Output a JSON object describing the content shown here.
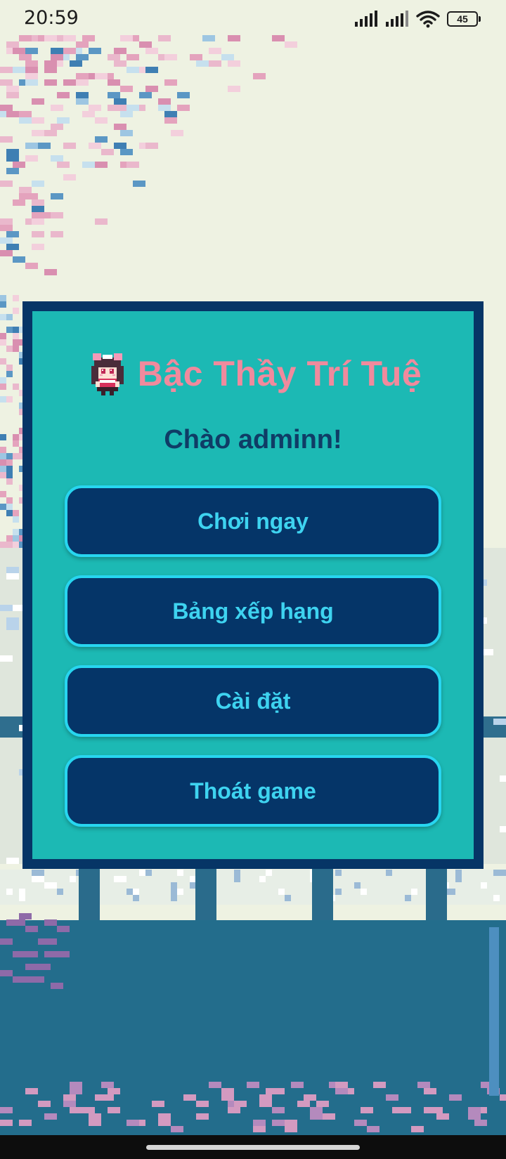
{
  "status_bar": {
    "time": "20:59",
    "battery_level": "45",
    "icons": [
      "signal-icon",
      "signal-icon",
      "wifi-icon",
      "battery-icon"
    ]
  },
  "menu": {
    "title": "Bậc Thầy Trí Tuệ",
    "greeting": "Chào adminn!",
    "buttons": {
      "play": "Chơi ngay",
      "leaderboard": "Bảng xếp hạng",
      "settings": "Cài đặt",
      "exit": "Thoát game"
    }
  },
  "colors": {
    "panel": "#1cb9b4",
    "panel_border": "#063566",
    "title": "#f08a9d",
    "button_fill": "#053568",
    "button_border": "#27d6f0",
    "button_text": "#3ed3f0",
    "background_sky": "#eef2e2",
    "background_water": "#236d8c",
    "blossom_pink": "#eab8cc"
  }
}
